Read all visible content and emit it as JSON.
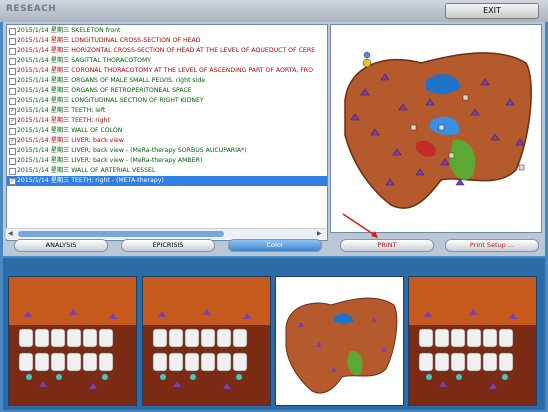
{
  "window": {
    "title": "RESEACH",
    "exit_label": "EXIT"
  },
  "list": [
    {
      "text": "2015/1/14 星期三 SKELETON front",
      "checked": false,
      "color": "#006400"
    },
    {
      "text": "2015/1/14 星期三 LONGITUDINAL CROSS-SECTION OF HEAD",
      "checked": false,
      "color": "#c00000"
    },
    {
      "text": "2015/1/14 星期三 HORIZONTAL CROSS-SECTION OF HEAD AT THE LEVEL OF AQUEDUCT OF CERE",
      "checked": false,
      "color": "#c00000"
    },
    {
      "text": "2015/1/14 星期三 SAGITTAL THORACOTOMY",
      "checked": false,
      "color": "#006400"
    },
    {
      "text": "2015/1/14 星期三 CORONAL THORACOTOMY AT THE LEVEL OF ASCENDING PART OF AORTA, FRO",
      "checked": false,
      "color": "#c00000"
    },
    {
      "text": "2015/1/14 星期三 ORGANS OF MALE SMALL PELVIS, right side",
      "checked": false,
      "color": "#006400"
    },
    {
      "text": "2015/1/14 星期三 ORGANS OF RETROPERITONEAL SPACE",
      "checked": false,
      "color": "#006400"
    },
    {
      "text": "2015/1/14 星期三 LONGITUDINAL SECTION OF RIGHT KIDNEY",
      "checked": false,
      "color": "#006400"
    },
    {
      "text": "2015/1/14 星期三 TEETH; left",
      "checked": true,
      "color": "#006400"
    },
    {
      "text": "2015/1/14 星期三 TEETH; right",
      "checked": true,
      "color": "#c00000"
    },
    {
      "text": "2015/1/14 星期三 WALL OF COLON",
      "checked": false,
      "color": "#006400"
    },
    {
      "text": "2015/1/14 星期三 LIVER; back view",
      "checked": true,
      "color": "#c00000"
    },
    {
      "text": "2015/1/14 星期三 LIVER; back view - (MeRa-therapy SORBUS AUCUPARIA*)",
      "checked": false,
      "color": "#006400"
    },
    {
      "text": "2015/1/14 星期三 LIVER; back view - (MeRa-therapy AMBER)",
      "checked": false,
      "color": "#006400"
    },
    {
      "text": "2015/1/14 星期三 WALL OF ARTERIAL VESSEL",
      "checked": false,
      "color": "#006400"
    },
    {
      "text": "2015/1/14 星期三 TEETH; right - (META-therapy)",
      "checked": true,
      "color": "#ffffff",
      "selected": true
    }
  ],
  "buttons": {
    "analysis": "ANALYSIS",
    "epicrisis": "EPICRISIS",
    "color": "Color",
    "print": "PRINT",
    "print_setup": "Print Setup ..."
  },
  "thumbnails": [
    "teeth",
    "teeth",
    "liver",
    "teeth"
  ]
}
